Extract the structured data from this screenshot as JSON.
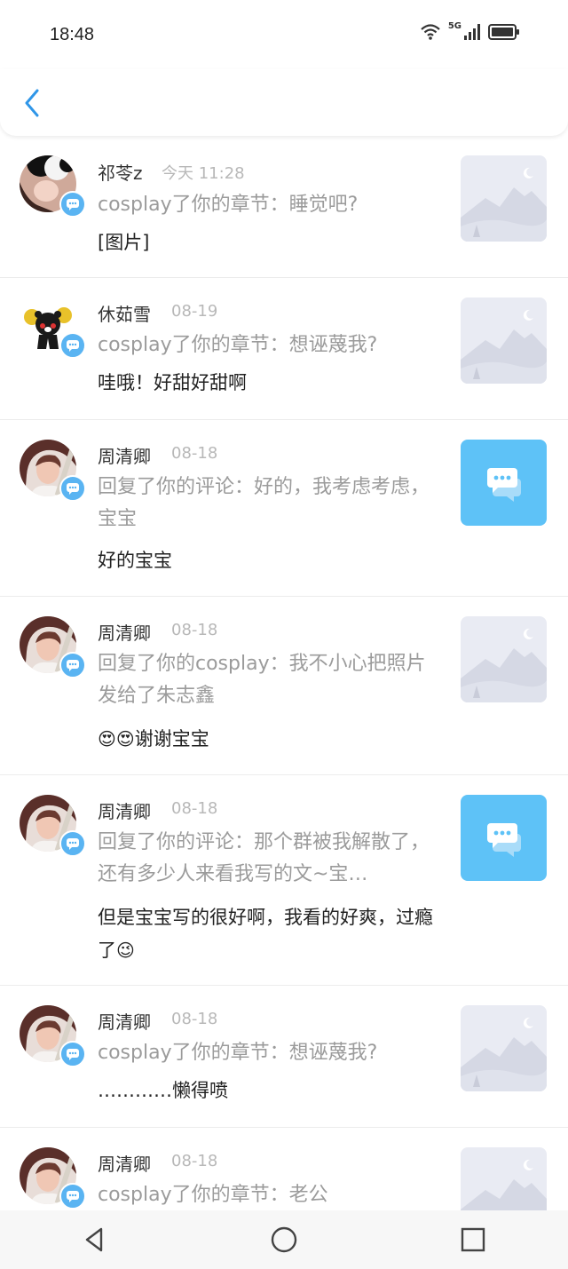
{
  "status": {
    "time": "18:48",
    "network": "5G"
  },
  "items": [
    {
      "name": "祁苓z",
      "date": "今天 11:28",
      "subtitle": "cosplay了你的章节：睡觉吧?",
      "content": "[图片]",
      "thumb": "image"
    },
    {
      "name": "休茹雪",
      "date": "08-19",
      "subtitle": "cosplay了你的章节：想诬蔑我?",
      "content": "哇哦！好甜好甜啊",
      "thumb": "image"
    },
    {
      "name": "周清卿",
      "date": "08-18",
      "subtitle": "回复了你的评论：好的，我考虑考虑，宝宝",
      "content": "好的宝宝",
      "thumb": "comment"
    },
    {
      "name": "周清卿",
      "date": "08-18",
      "subtitle": "回复了你的cosplay：我不小心把照片发给了朱志鑫",
      "content_emoji": "😍😍",
      "content": "谢谢宝宝",
      "thumb": "image"
    },
    {
      "name": "周清卿",
      "date": "08-18",
      "subtitle": "回复了你的评论：那个群被我解散了，还有多少人来看我写的文~宝…",
      "content": "但是宝宝写的很好啊，我看的好爽，过瘾了",
      "content_emoji": "😉",
      "thumb": "comment"
    },
    {
      "name": "周清卿",
      "date": "08-18",
      "subtitle": "cosplay了你的章节：想诬蔑我?",
      "content": "…………懒得喷",
      "thumb": "image"
    },
    {
      "name": "周清卿",
      "date": "08-18",
      "subtitle": "cosplay了你的章节：老公",
      "content": "",
      "thumb": "image"
    }
  ]
}
